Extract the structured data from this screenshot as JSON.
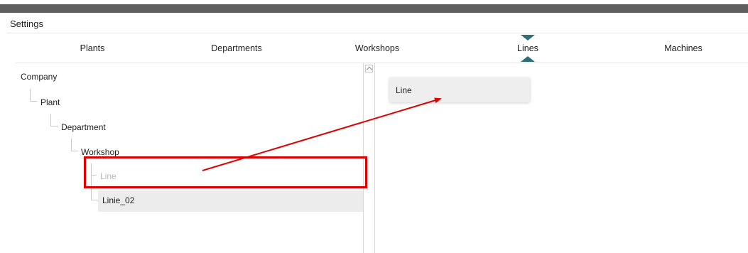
{
  "settings": {
    "title": "Settings"
  },
  "tabs": [
    {
      "label": "Plants"
    },
    {
      "label": "Departments"
    },
    {
      "label": "Workshops"
    },
    {
      "label": "Lines",
      "active": true
    },
    {
      "label": "Machines"
    }
  ],
  "tree": {
    "company": "Company",
    "plant": "Plant",
    "department": "Department",
    "workshop": "Workshop",
    "line_placeholder": "Line",
    "line_existing": "Linie_02"
  },
  "palette": {
    "card_label": "Line"
  },
  "colors": {
    "accent": "#2f6f78",
    "annotation": "#e00000",
    "placeholder_text": "#b8b8b8"
  },
  "icons": {
    "scroll_up": "chevron-up-icon",
    "tab_marker": "triangle-icon"
  }
}
